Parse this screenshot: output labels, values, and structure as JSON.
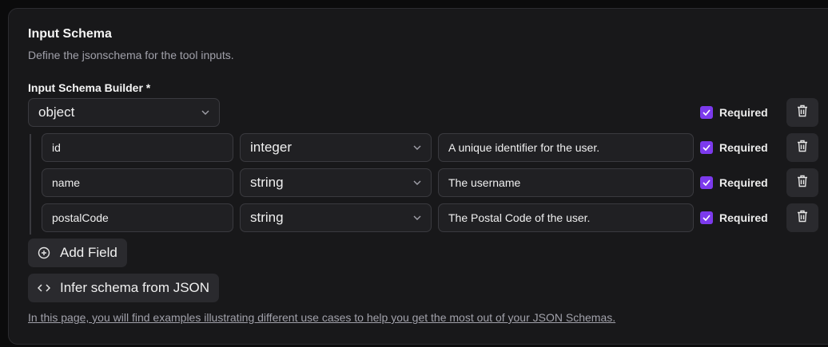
{
  "header": {
    "title": "Input Schema",
    "subtitle": "Define the jsonschema for the tool inputs."
  },
  "builder": {
    "label": "Input Schema Builder *",
    "root_type": "object",
    "root_required_label": "Required",
    "root_required": true
  },
  "fields": [
    {
      "name": "id",
      "type": "integer",
      "description": "A unique identifier for the user.",
      "required_label": "Required",
      "required": true
    },
    {
      "name": "name",
      "type": "string",
      "description": "The username",
      "required_label": "Required",
      "required": true
    },
    {
      "name": "postalCode",
      "type": "string",
      "description": "The Postal Code of the user.",
      "required_label": "Required",
      "required": true
    }
  ],
  "actions": {
    "add_field": "Add Field",
    "infer_schema": "Infer schema from JSON"
  },
  "footer": {
    "link_text": "In this page, you will find examples illustrating different use cases to help you get the most out of your JSON Schemas."
  },
  "colors": {
    "accent": "#7c3aed",
    "background": "#18181a",
    "muted_text": "#a1a1aa"
  }
}
